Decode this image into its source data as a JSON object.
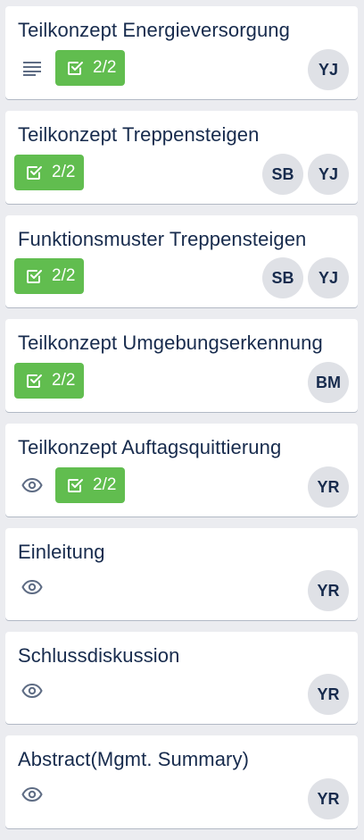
{
  "cards": [
    {
      "title": "Teilkonzept Energieversorgung",
      "checklist": "2/2",
      "members": [
        "YJ"
      ]
    },
    {
      "title": "Teilkonzept Treppensteigen",
      "checklist": "2/2",
      "members": [
        "SB",
        "YJ"
      ]
    },
    {
      "title": "Funktionsmuster Treppensteigen",
      "checklist": "2/2",
      "members": [
        "SB",
        "YJ"
      ]
    },
    {
      "title": "Teilkonzept Umgebungserkennung",
      "checklist": "2/2",
      "members": [
        "BM"
      ]
    },
    {
      "title": "Teilkonzept Auftagsquittierung",
      "checklist": "2/2",
      "members": [
        "YR"
      ]
    },
    {
      "title": "Einleitung",
      "members": [
        "YR"
      ]
    },
    {
      "title": "Schlussdiskussion",
      "members": [
        "YR"
      ]
    },
    {
      "title": "Abstract(Mgmt. Summary)",
      "members": [
        "YR"
      ]
    }
  ],
  "icons": {
    "description": "description-icon",
    "watch": "eye-icon",
    "checklist": "checklist-icon"
  },
  "colors": {
    "board_bg": "#ebecf0",
    "card_bg": "#ffffff",
    "checklist_complete": "#61bd4f",
    "avatar_bg": "#dfe1e6",
    "text": "#172b4d",
    "icon": "#5e6c84"
  }
}
